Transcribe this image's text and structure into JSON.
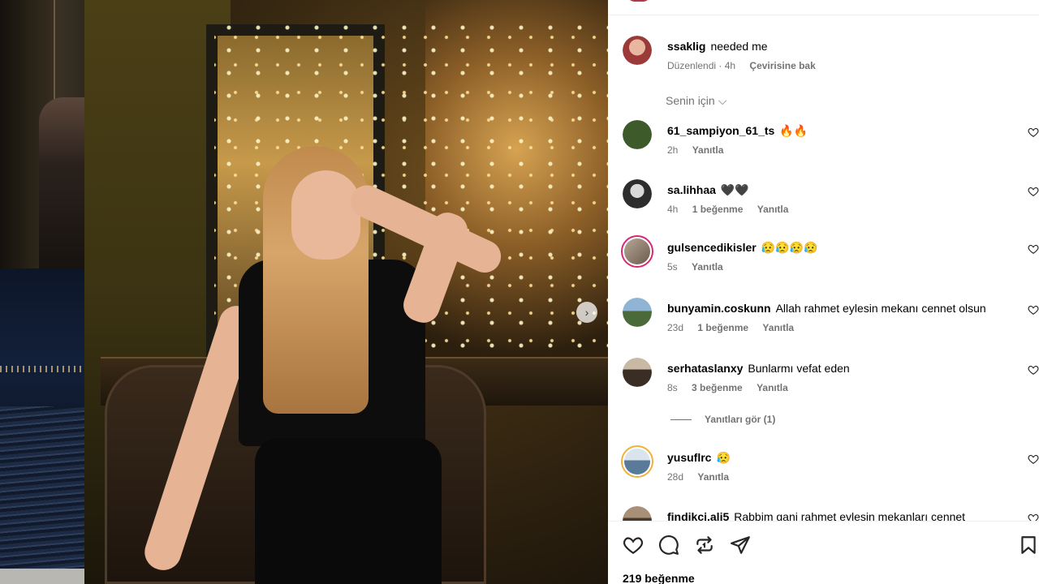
{
  "post": {
    "likes_label": "219 beğenme"
  },
  "caption": {
    "user": "ssaklig",
    "text": "needed me",
    "edited": "Düzenlendi · 4h",
    "translate": "Çevirisine bak"
  },
  "sort_label": "Senin için",
  "comments": [
    {
      "user": "61_sampiyon_61_ts",
      "text": "🔥🔥",
      "time": "2h",
      "likes": "",
      "reply": "Yanıtla",
      "avatar_color": "#3c5a2a"
    },
    {
      "user": "sa.lihhaa",
      "text": "🖤🖤",
      "time": "4h",
      "likes": "1 beğenme",
      "reply": "Yanıtla",
      "avatar_color": "#2d2d2d"
    },
    {
      "user": "gulsencedikisler",
      "text": "😥😥😥😥",
      "time": "5s",
      "likes": "",
      "reply": "Yanıtla",
      "avatar_color": "#7a6a5c"
    },
    {
      "user": "bunyamin.coskunn",
      "text": "Allah rahmet eylesin mekanı cennet olsun",
      "time": "23d",
      "likes": "1 beğenme",
      "reply": "Yanıtla",
      "avatar_color": "#4a6f8f"
    },
    {
      "user": "serhataslanxy",
      "text": "Bunlarmı vefat eden",
      "time": "8s",
      "likes": "3 beğenme",
      "reply": "Yanıtla",
      "avatar_color": "#5a4a3a"
    },
    {
      "user": "yusuflrc",
      "text": "😥",
      "time": "28d",
      "likes": "",
      "reply": "Yanıtla",
      "avatar_color": "#8aa2b8"
    },
    {
      "user": "findikci.ali5",
      "text": "Rabbim gani rahmet eylesin mekanları cennet",
      "time": "",
      "likes": "",
      "reply": "",
      "avatar_color": "#6e5a48"
    }
  ],
  "view_replies": "Yanıtları gör (1)",
  "icons": {
    "like": "heart-icon",
    "comment": "comment-icon",
    "share": "repost-icon",
    "send": "send-icon",
    "save": "bookmark-icon",
    "next": "chevron-right-icon"
  },
  "colors": {
    "accent_ring": "#d62976",
    "meta": "#737373"
  }
}
